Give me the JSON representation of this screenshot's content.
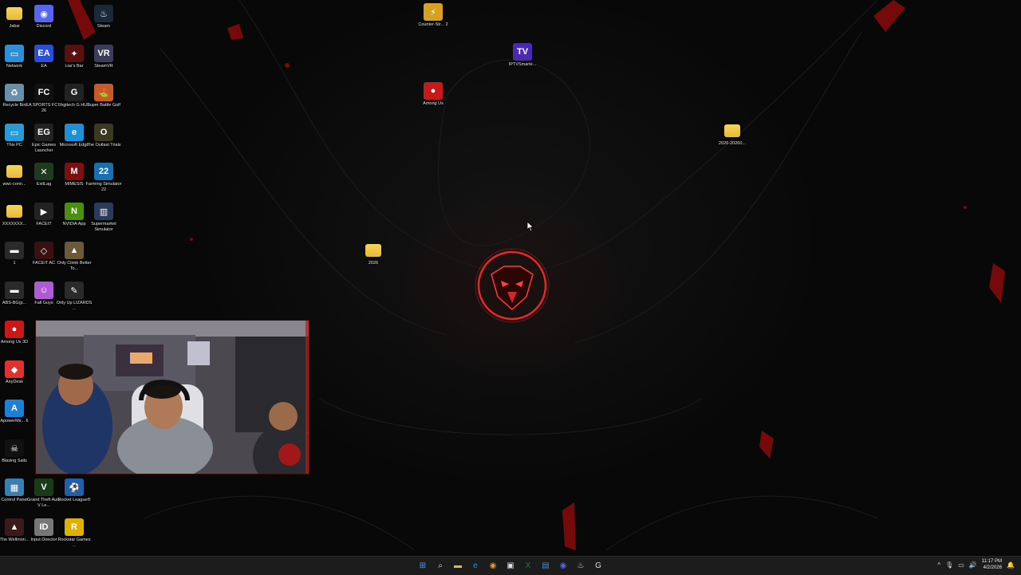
{
  "desktop_icons": [
    {
      "id": "jabsi",
      "label": "Jabsi",
      "type": "folder",
      "color": "#e7b93a"
    },
    {
      "id": "discord",
      "label": "Discord",
      "type": "app",
      "color": "#5865f2",
      "glyph": "◉"
    },
    {
      "id": "steam",
      "label": "Steam",
      "type": "app",
      "color": "#1b2838",
      "glyph": "♨"
    },
    {
      "id": "network",
      "label": "Network",
      "type": "app",
      "color": "#2d8fd6",
      "glyph": "▭"
    },
    {
      "id": "ea",
      "label": "EA",
      "type": "app",
      "color": "#2a4fd6",
      "glyph": "EA"
    },
    {
      "id": "liars-bar",
      "label": "Liar's Bar",
      "type": "app",
      "color": "#5a1010",
      "glyph": "✦"
    },
    {
      "id": "steamvr",
      "label": "SteamVR",
      "type": "app",
      "color": "#3b3b5a",
      "glyph": "VR"
    },
    {
      "id": "recycle-bin",
      "label": "Recycle Bin",
      "type": "app",
      "color": "#6a8fa8",
      "glyph": "♻"
    },
    {
      "id": "ea-fc",
      "label": "EA SPORTS FC™ 26",
      "type": "app",
      "color": "#111",
      "glyph": "FC"
    },
    {
      "id": "logitech",
      "label": "Logitech G HUB",
      "type": "app",
      "color": "#222",
      "glyph": "G"
    },
    {
      "id": "super-battle-golf",
      "label": "Super Battle Golf",
      "type": "app",
      "color": "#c85a2a",
      "glyph": "⛳"
    },
    {
      "id": "this-pc",
      "label": "This PC",
      "type": "app",
      "color": "#2a9ad6",
      "glyph": "▭"
    },
    {
      "id": "epic",
      "label": "Epic Games Launcher",
      "type": "app",
      "color": "#222",
      "glyph": "EG"
    },
    {
      "id": "edge",
      "label": "Microsoft Edge",
      "type": "app",
      "color": "#1f8fd6",
      "glyph": "e"
    },
    {
      "id": "outlast",
      "label": "The Outlast Trials",
      "type": "app",
      "color": "#3a3a20",
      "glyph": "O"
    },
    {
      "id": "wwc-conn",
      "label": "wwc-conn...",
      "type": "folder",
      "color": "#e7b93a"
    },
    {
      "id": "exitlag",
      "label": "ExitLag",
      "type": "app",
      "color": "#1f3a1f",
      "glyph": "✕"
    },
    {
      "id": "mimesis",
      "label": "MIMESIS",
      "type": "app",
      "color": "#7a1010",
      "glyph": "M"
    },
    {
      "id": "farming-sim",
      "label": "Farming Simulator 22",
      "type": "app",
      "color": "#1a6fb0",
      "glyph": "22"
    },
    {
      "id": "xxxxx",
      "label": "XXXXXXX...",
      "type": "folder",
      "color": "#e7b93a"
    },
    {
      "id": "faceit",
      "label": "FACEIT",
      "type": "app",
      "color": "#222",
      "glyph": "▶"
    },
    {
      "id": "nvidia",
      "label": "NVIDIA App",
      "type": "app",
      "color": "#4a8f10",
      "glyph": "N"
    },
    {
      "id": "supermarket",
      "label": "Supermarket Simulator",
      "type": "app",
      "color": "#2a3a5a",
      "glyph": "▥"
    },
    {
      "id": "one",
      "label": "1",
      "type": "app",
      "color": "#2a2a2a",
      "glyph": "▬"
    },
    {
      "id": "faceit-ac",
      "label": "FACEIT AC",
      "type": "app",
      "color": "#3a1010",
      "glyph": "◇"
    },
    {
      "id": "only-climb",
      "label": "Only Climb Better To...",
      "type": "app",
      "color": "#6a5a3a",
      "glyph": "▲"
    },
    {
      "id": "abs-bg",
      "label": "ABS-BG(p...",
      "type": "app",
      "color": "#2a2a2a",
      "glyph": "▬"
    },
    {
      "id": "fall-guys",
      "label": "Fall Guys",
      "type": "app",
      "color": "#b05ad6",
      "glyph": "☺"
    },
    {
      "id": "only-up",
      "label": "Only Up LIZARDS ...",
      "type": "app",
      "color": "#2a2a2a",
      "glyph": "✎"
    },
    {
      "id": "among-us-3d",
      "label": "Among Us 3D",
      "type": "app",
      "color": "#c81818",
      "glyph": "●"
    },
    {
      "id": "anydesk",
      "label": "AnyDesk",
      "type": "app",
      "color": "#e03030",
      "glyph": "◆"
    },
    {
      "id": "apowermirror",
      "label": "ApowerMir... 6",
      "type": "app",
      "color": "#1f7fd6",
      "glyph": "A"
    },
    {
      "id": "blazing-sails",
      "label": "Blazing Sails",
      "type": "app",
      "color": "#111",
      "glyph": "☠"
    },
    {
      "id": "control-panel",
      "label": "Control Panel",
      "type": "app",
      "color": "#3a7fb0",
      "glyph": "▦"
    },
    {
      "id": "gta5",
      "label": "Grand Theft Auto V Le...",
      "type": "app",
      "color": "#1a3a1a",
      "glyph": "V"
    },
    {
      "id": "rocket-league",
      "label": "Rocket League®",
      "type": "app",
      "color": "#1f5fb0",
      "glyph": "⚽"
    },
    {
      "id": "wellmonster",
      "label": "The Wellmon...",
      "type": "app",
      "color": "#3a1a1a",
      "glyph": "▲"
    },
    {
      "id": "input-director",
      "label": "Input Director",
      "type": "app",
      "color": "#777",
      "glyph": "ID"
    },
    {
      "id": "rockstar",
      "label": "Rockstar Games ...",
      "type": "app",
      "color": "#e0b000",
      "glyph": "R"
    },
    {
      "id": "counter-strike",
      "label": "Counter-Str... 2",
      "type": "app",
      "color": "#d6a020",
      "glyph": "⚡"
    },
    {
      "id": "iptv",
      "label": "IPTVSmarte...",
      "type": "app",
      "color": "#4a2ab0",
      "glyph": "TV"
    },
    {
      "id": "among-us",
      "label": "Among Us",
      "type": "app",
      "color": "#c81818",
      "glyph": "●"
    },
    {
      "id": "folder-2026-20260",
      "label": "2026-20260...",
      "type": "folder",
      "color": "#e7b93a"
    },
    {
      "id": "folder-2026",
      "label": "2026",
      "type": "folder",
      "color": "#e7b93a"
    }
  ],
  "taskbar": {
    "start_label": "Start",
    "search_label": "Search",
    "pinned": [
      {
        "id": "start",
        "glyph": "⊞",
        "color": "#3fa0ff"
      },
      {
        "id": "search",
        "glyph": "⌕",
        "color": "#ddd"
      },
      {
        "id": "file-explorer",
        "glyph": "▬",
        "color": "#e7b93a"
      },
      {
        "id": "edge",
        "glyph": "e",
        "color": "#1f8fd6"
      },
      {
        "id": "chrome",
        "glyph": "◉",
        "color": "#e0a020"
      },
      {
        "id": "store",
        "glyph": "▣",
        "color": "#ddd"
      },
      {
        "id": "excel",
        "glyph": "X",
        "color": "#1d7a45"
      },
      {
        "id": "notepad",
        "glyph": "▤",
        "color": "#3a8fd6"
      },
      {
        "id": "discord",
        "glyph": "◉",
        "color": "#5865f2"
      },
      {
        "id": "steam",
        "glyph": "♨",
        "color": "#ddd"
      },
      {
        "id": "logitech",
        "glyph": "G",
        "color": "#ddd"
      }
    ],
    "tray": {
      "chevron": "^",
      "time": "11:17 PM",
      "date": "4/2/2026"
    }
  }
}
